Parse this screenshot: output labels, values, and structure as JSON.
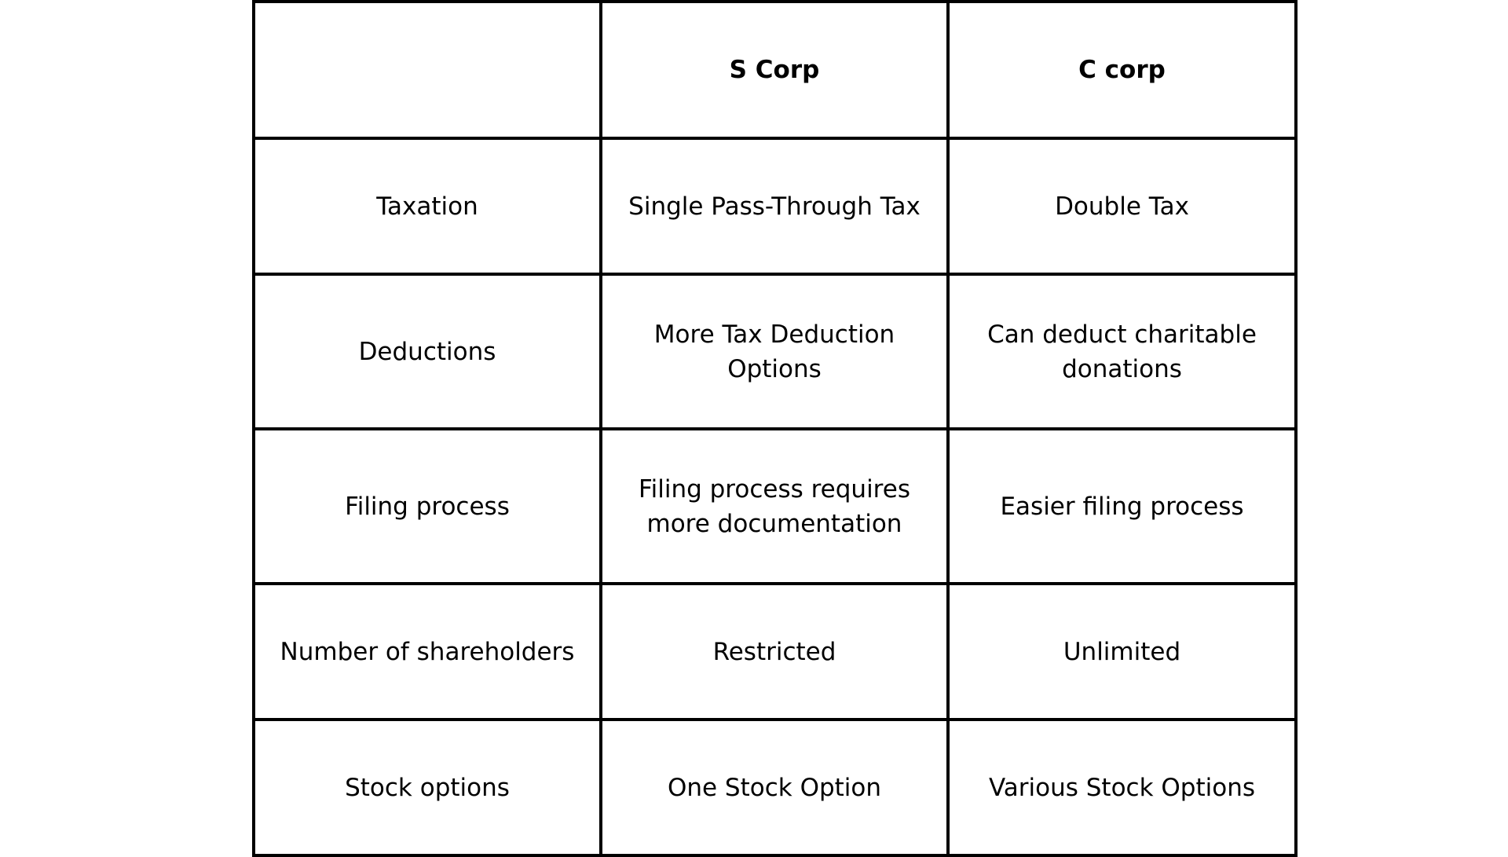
{
  "table": {
    "headers": [
      "",
      "S Corp",
      "C corp"
    ],
    "rows": [
      {
        "feature": "Taxation",
        "s_corp": "Single Pass-Through Tax",
        "c_corp": "Double Tax"
      },
      {
        "feature": "Deductions",
        "s_corp": "More Tax Deduction Options",
        "c_corp": "Can deduct charitable donations"
      },
      {
        "feature": "Filing process",
        "s_corp": "Filing process requires more documentation",
        "c_corp": "Easier filing process"
      },
      {
        "feature": "Number of shareholders",
        "s_corp": "Restricted",
        "c_corp": "Unlimited"
      },
      {
        "feature": "Stock options",
        "s_corp": "One Stock Option",
        "c_corp": "Various Stock Options"
      }
    ]
  }
}
